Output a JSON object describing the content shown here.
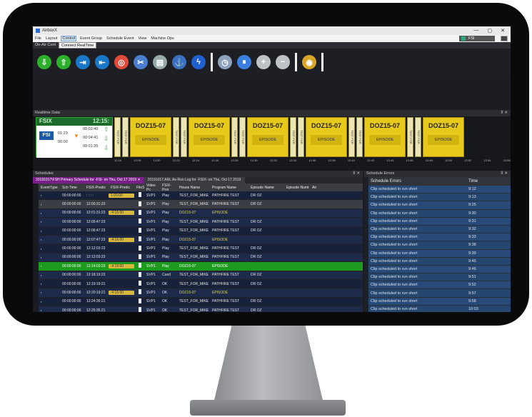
{
  "app": {
    "title": "AirboxX",
    "window_buttons": [
      "—",
      "▢",
      "✕"
    ]
  },
  "menu": {
    "items": [
      "File",
      "Layout",
      "Control",
      "Event Group",
      "Schedule Event",
      "View",
      "Machine Ops"
    ],
    "selected": "Control",
    "tooltip": "Connect RealTime",
    "channel": "FSI"
  },
  "onair_bar": {
    "label": "On-Air Cont"
  },
  "toolbar": {
    "buttons": [
      {
        "icon": "down-arrow-icon",
        "color": "#2db12d"
      },
      {
        "icon": "up-arrow-icon",
        "color": "#2db12d"
      },
      {
        "icon": "skip-icon",
        "color": "#1a78c8"
      },
      {
        "icon": "skip-alt-icon",
        "color": "#1a78c8"
      },
      {
        "icon": "lifebuoy-icon",
        "color": "#e24a3a"
      },
      {
        "icon": "cut-icon",
        "color": "#4a7fd0"
      },
      {
        "icon": "clear-list-icon",
        "color": "#9aa"
      },
      {
        "icon": "anchor-icon",
        "color": "#3c6fc2"
      },
      {
        "icon": "bolt-icon",
        "color": "#1f5fd0"
      },
      {
        "icon": "clock-icon",
        "color": "#8fa2bd"
      },
      {
        "icon": "pause-icon",
        "color": "#3b7fe0"
      },
      {
        "icon": "plus-icon",
        "color": "#bfc3c8"
      },
      {
        "icon": "minus-icon",
        "color": "#bfc3c8"
      },
      {
        "icon": "globe-icon",
        "color": "#d8a42a"
      }
    ]
  },
  "realtime": {
    "title": "Realtime Data",
    "channel": "FSIX",
    "clock": "12:15:",
    "times": [
      "00:02:40",
      "00:04:41",
      "00:01:35"
    ],
    "small_left": [
      "01:23",
      "00:00"
    ],
    "events": [
      {
        "title": "DOZ15-07",
        "sub": "EPISODE"
      },
      {
        "title": "DOZ15-07",
        "sub": "EPISODE"
      },
      {
        "title": "DOZ15-07",
        "sub": "EPISODE"
      },
      {
        "title": "DOZ15-07",
        "sub": "EPISODE"
      },
      {
        "title": "DOZ15-07",
        "sub": "EPISODE"
      },
      {
        "title": "DOZ15-07",
        "sub": "EPISODE"
      }
    ],
    "promo_label": "TEST FOR",
    "ticks": [
      "12:16",
      "12:18",
      "12:20",
      "12:22",
      "12:24",
      "12:26",
      "12:28",
      "12:30",
      "12:32",
      "12:34",
      "12:36",
      "12:38",
      "12:40",
      "12:42",
      "12:44",
      "12:46",
      "12:48",
      "12:50",
      "12:52",
      "12:54",
      "12:56"
    ]
  },
  "schedules": {
    "title": "Schedules",
    "tabs": [
      "20191017\\FSH  Primary Schedule for -FSI- on Thu, Oct 17 2019 ✕",
      "20191017.ARL  As-Run Log for -FSIX- on Thu, Oct 17 2019"
    ],
    "columns": [
      "EventType",
      "Sch Time",
      "FSIX-Predic",
      "FSIX-Predic",
      "FileS",
      "Video Pc",
      "FSIX-Pror",
      "House Name",
      "Program Name",
      "Episode Name",
      "Episode Numt",
      "Air"
    ],
    "rows": [
      {
        "sch": "00:00:00:00",
        "p1": ": : : :",
        "p2": "1:00:00",
        "vid": "SVP1",
        "st": "Play",
        "house": "TEST_FOR_MIKE",
        "prog": "PATHFIRE TEST",
        "ep": "DR OZ",
        "style": "even"
      },
      {
        "sch": "00:00:00:00",
        "p1": "12:00:31:23",
        "p2": "",
        "vid": "SVP1",
        "st": "Play",
        "house": "TEST_FOR_MIKE",
        "prog": "PATHFIRE TEST",
        "ep": "DR OZ",
        "style": "gray"
      },
      {
        "sch": "00:00:00:00",
        "p1": "12:01:31:23",
        "p2": ":4:16:00",
        "vid": "SVP1",
        "st": "Play",
        "house": "DOZ15-07",
        "prog": "EPISODE",
        "ep": "",
        "style": "grn"
      },
      {
        "sch": "00:00:00:00",
        "p1": "12:05:47:23",
        "p2": "",
        "vid": "SVP1",
        "st": "Play",
        "house": "TEST_FOR_MIKE",
        "prog": "PATHFIRE TEST",
        "ep": "DR OZ",
        "style": "odd"
      },
      {
        "sch": "00:00:00:00",
        "p1": "12:06:47:23",
        "p2": "",
        "vid": "SVP1",
        "st": "Play",
        "house": "TEST_FOR_MIKE",
        "prog": "PATHFIRE TEST",
        "ep": "DR OZ",
        "style": "even"
      },
      {
        "sch": "00:00:00:00",
        "p1": "12:07:47:23",
        "p2": ":4:16:00",
        "vid": "SVP1",
        "st": "Play",
        "house": "DOZ15-07",
        "prog": "EPISODE",
        "ep": "",
        "style": "grn"
      },
      {
        "sch": "00:00:00:00",
        "p1": "12:12:03:23",
        "p2": "",
        "vid": "SVP1",
        "st": "Play",
        "house": "TEST_FOR_MIKE",
        "prog": "PATHFIRE TEST",
        "ep": "DR OZ",
        "style": "even"
      },
      {
        "sch": "00:00:00:00",
        "p1": "12:13:03:23",
        "p2": "",
        "vid": "SVP1",
        "st": "Play",
        "house": "TEST_FOR_MIKE",
        "prog": "PATHFIRE TEST",
        "ep": "DR OZ",
        "style": "odd"
      },
      {
        "sch": "00:00:00:00",
        "p1": "12:14:03:23",
        "p2": ":4:16:00",
        "vid": "SVP1",
        "st": "Play",
        "house": "DOZ15-07",
        "prog": "EPISODE",
        "ep": "",
        "style": "hl"
      },
      {
        "sch": "00:00:00:00",
        "p1": "12:18:19:23",
        "p2": "",
        "vid": "SVP1",
        "st": "Cued",
        "house": "TEST_FOR_MIKE",
        "prog": "PATHFIRE TEST",
        "ep": "DR OZ",
        "style": "odd"
      },
      {
        "sch": "00:00:00:00",
        "p1": "12:19:19:21",
        "p2": "",
        "vid": "SVP1",
        "st": "OK",
        "house": "TEST_FOR_MIKE",
        "prog": "PATHFIRE TEST",
        "ep": "DR OZ",
        "style": "even"
      },
      {
        "sch": "00:00:00:00",
        "p1": "12:20:19:21",
        "p2": ":4:16:00",
        "vid": "SVP1",
        "st": "OK",
        "house": "DOZ15-07",
        "prog": "EPISODE",
        "ep": "",
        "style": "grn"
      },
      {
        "sch": "00:00:00:00",
        "p1": "12:24:35:21",
        "p2": "",
        "vid": "SVP1",
        "st": "OK",
        "house": "TEST_FOR_MIKE",
        "prog": "PATHFIRE TEST",
        "ep": "DR OZ",
        "style": "even"
      },
      {
        "sch": "00:00:00:00",
        "p1": "12:25:35:21",
        "p2": "",
        "vid": "SVP1",
        "st": "OK",
        "house": "TEST_FOR_MIKE",
        "prog": "PATHFIRE TEST",
        "ep": "DR OZ",
        "style": "odd"
      },
      {
        "sch": "00:00:00:00",
        "p1": "12:26:35:21",
        "p2": ":4:16:00",
        "vid": "SVP1",
        "st": "OK",
        "house": "DOZ15-07",
        "prog": "EPISODE",
        "ep": "",
        "style": "grn"
      }
    ]
  },
  "schedule_errors": {
    "title": "Schedule Errors",
    "columns": [
      "Schedule Errors",
      "Time"
    ],
    "rows": [
      {
        "msg": "Clip scheduled to run short",
        "time": "9:12"
      },
      {
        "msg": "Clip scheduled to run short",
        "time": "9:13"
      },
      {
        "msg": "Clip scheduled to run short",
        "time": "9:25"
      },
      {
        "msg": "Clip scheduled to run short",
        "time": "9:30"
      },
      {
        "msg": "Clip scheduled to run short",
        "time": "9:31"
      },
      {
        "msg": "Clip scheduled to run short",
        "time": "9:32"
      },
      {
        "msg": "Clip scheduled to run short",
        "time": "9:33"
      },
      {
        "msg": "Clip scheduled to run short",
        "time": "9:38"
      },
      {
        "msg": "Clip scheduled to run short",
        "time": "9:39"
      },
      {
        "msg": "Clip scheduled to run short",
        "time": "9:45"
      },
      {
        "msg": "Clip scheduled to run short",
        "time": "9:46"
      },
      {
        "msg": "Clip scheduled to run short",
        "time": "9:51"
      },
      {
        "msg": "Clip scheduled to run short",
        "time": "9:52"
      },
      {
        "msg": "Clip scheduled to run short",
        "time": "9:57"
      },
      {
        "msg": "Clip scheduled to run short",
        "time": "9:58"
      },
      {
        "msg": "Clip scheduled to run short",
        "time": "10:03"
      },
      {
        "msg": "Clip scheduled to run short",
        "time": "10:04"
      }
    ]
  }
}
